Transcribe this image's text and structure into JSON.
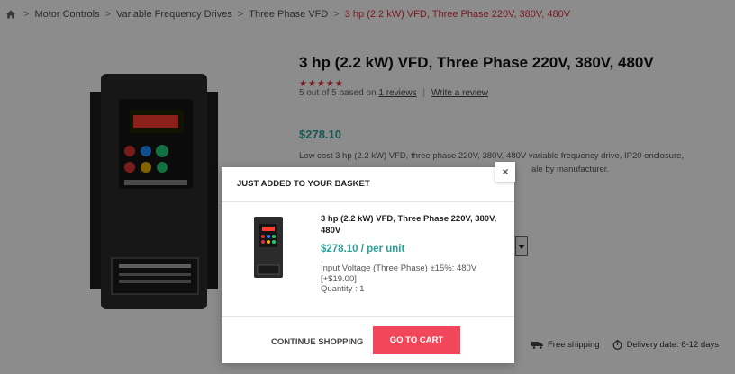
{
  "breadcrumb": {
    "items": [
      "Motor Controls",
      "Variable Frequency Drives",
      "Three Phase VFD"
    ],
    "current": "3 hp (2.2 kW) VFD, Three Phase 220V, 380V, 480V"
  },
  "product": {
    "title": "3 hp (2.2 kW) VFD, Three Phase 220V, 380V, 480V",
    "stars": "★★★★★",
    "rating_text": "5 out of 5 based on",
    "reviews_link": "1 reviews",
    "write_review_link": "Write a review",
    "price": "$278.10",
    "description_line1": "Low cost 3 hp (2.2 kW) VFD, three phase 220V, 380V, 480V variable frequency drive, IP20 enclosure,",
    "description_line2": "ale by manufacturer."
  },
  "shipping": {
    "free_shipping": "Free shipping",
    "delivery": "Delivery date: 6-12 days"
  },
  "modal": {
    "close": "×",
    "heading": "JUST ADDED TO YOUR BASKET",
    "item_title": "3 hp (2.2 kW) VFD, Three Phase 220V, 380V, 480V",
    "item_price": "$278.10 / per unit",
    "option_line": "Input Voltage (Three Phase) ±15%: 480V",
    "option_extra": "[+$19.00]",
    "quantity": "Quantity : 1",
    "continue_label": "CONTINUE SHOPPING",
    "cart_label": "GO TO CART"
  },
  "colors": {
    "accent_red": "#e03040",
    "price_teal": "#2aa198",
    "cart_button": "#f2475a"
  }
}
